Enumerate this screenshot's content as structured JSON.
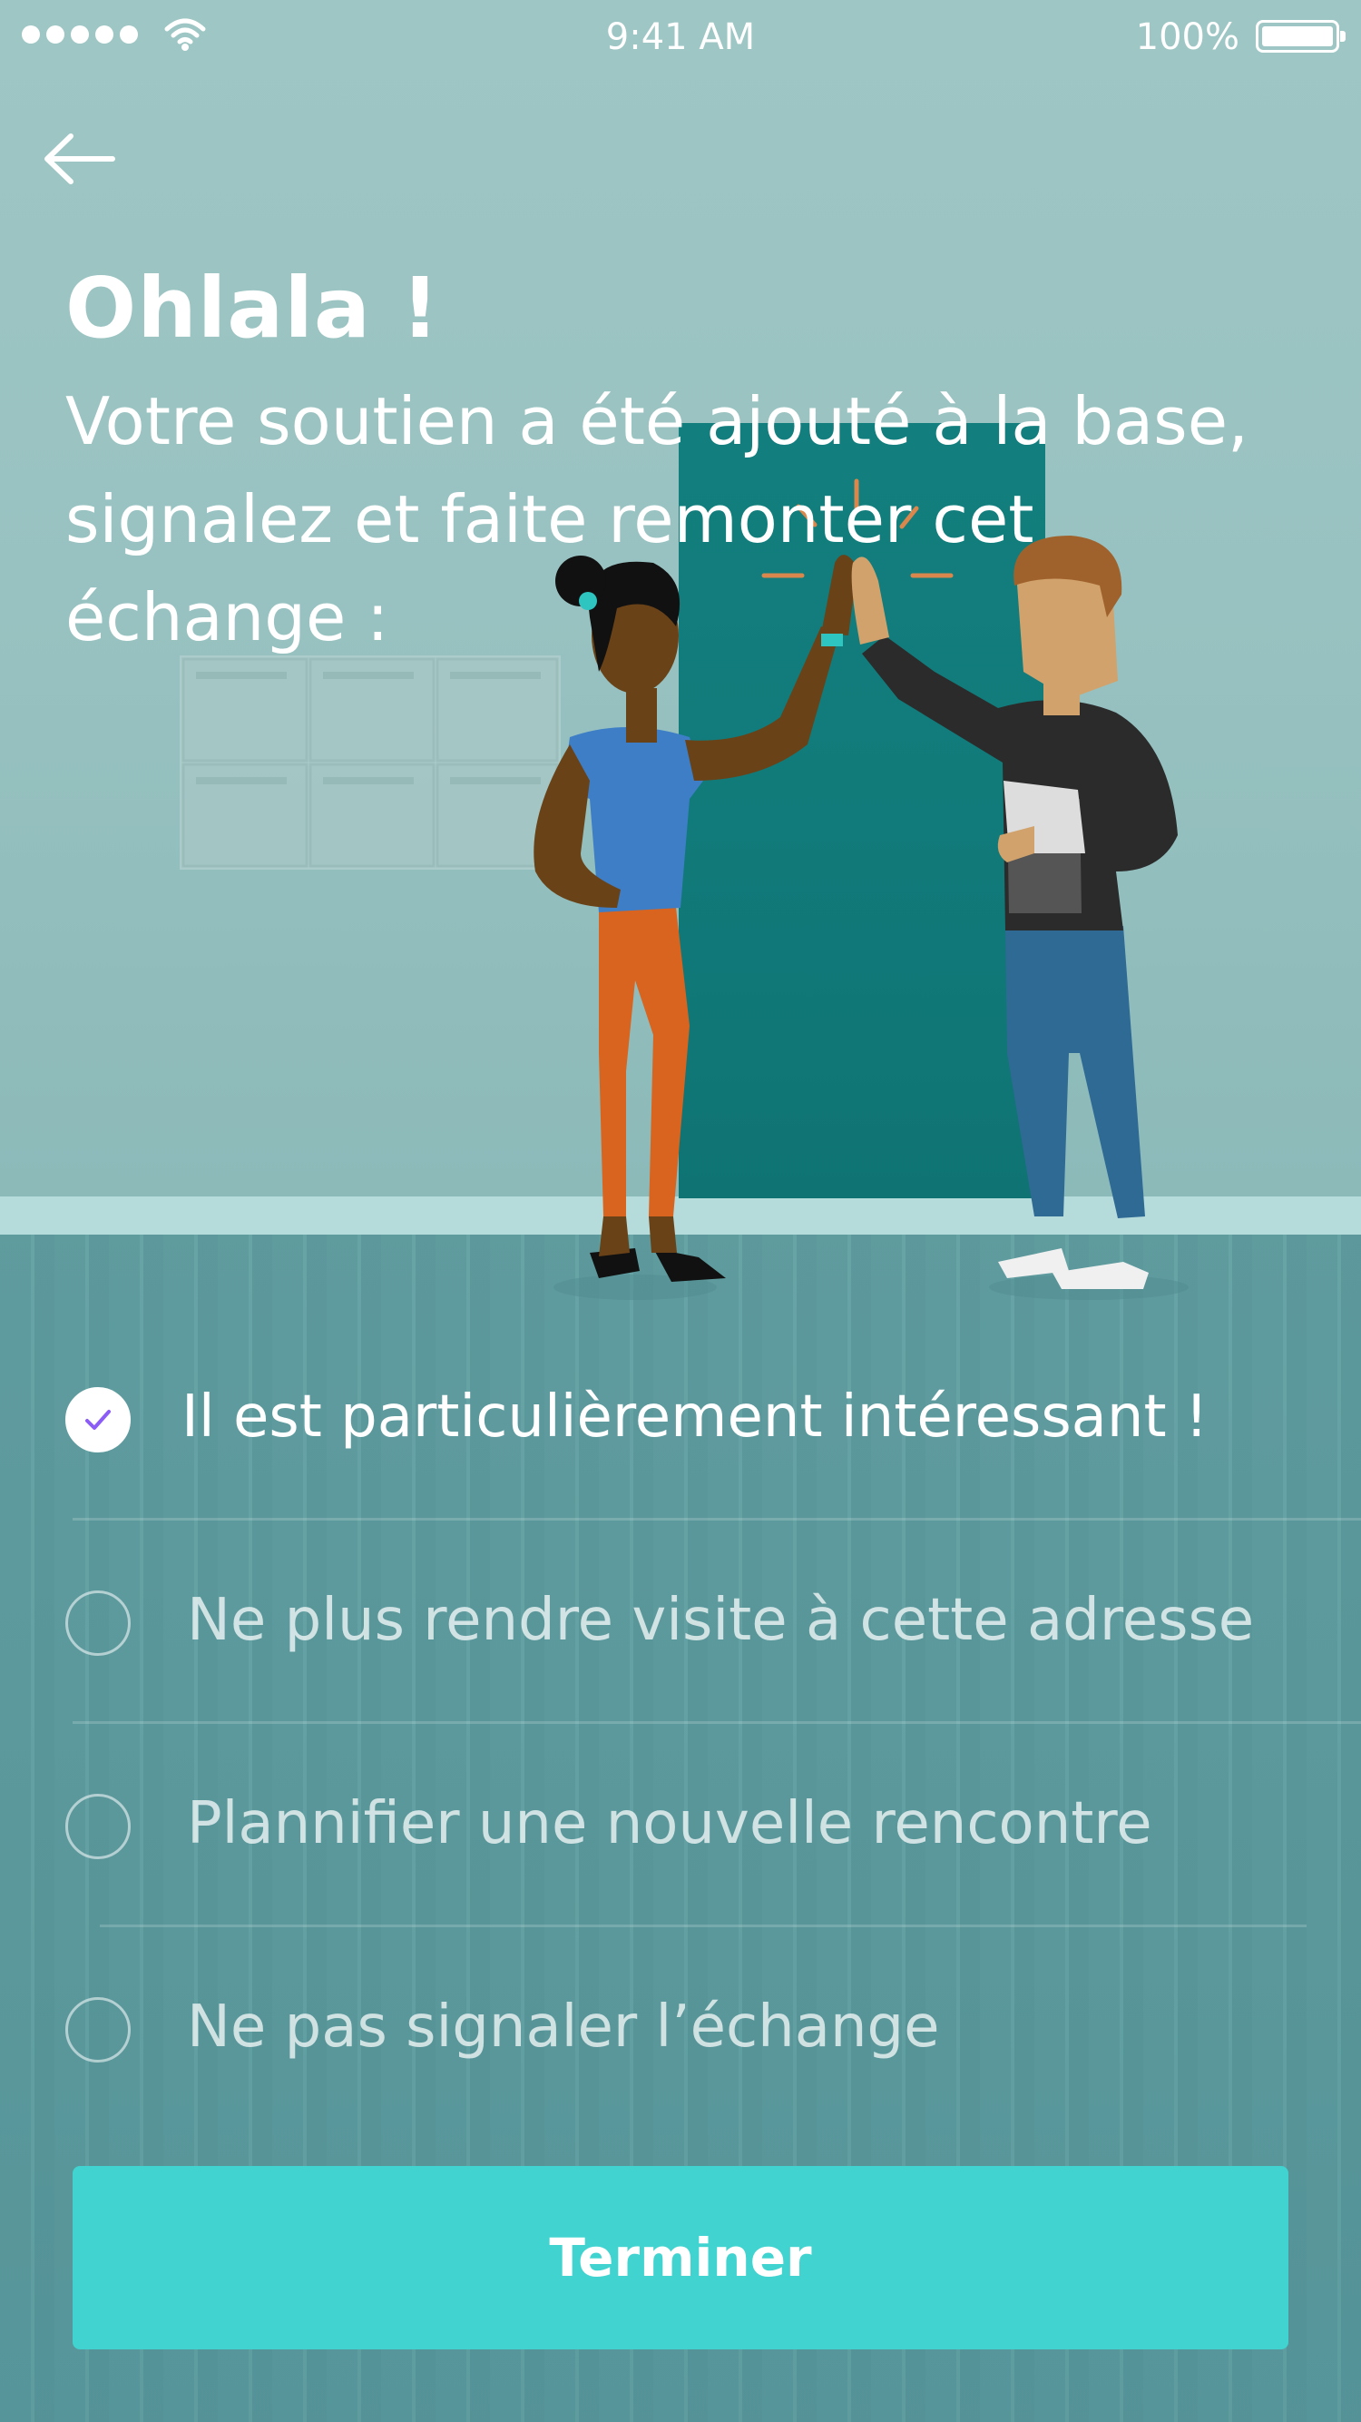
{
  "status_bar": {
    "time": "9:41 AM",
    "battery": "100%",
    "icons": [
      "signal-dots-icon",
      "wifi-icon",
      "battery-icon"
    ]
  },
  "nav": {
    "back_icon": "arrow-left-icon"
  },
  "header": {
    "title": "Ohlala !",
    "subtitle": "Votre soutien a été ajouté à la base, signalez et faite remonter cet échange :"
  },
  "options": [
    {
      "label": "Il est particulièrement intéressant  !",
      "checked": true
    },
    {
      "label": "Ne plus rendre visite à cette adresse",
      "checked": false
    },
    {
      "label": "Plannifier une nouvelle rencontre",
      "checked": false
    },
    {
      "label": "Ne pas signaler l’échange",
      "checked": false
    }
  ],
  "actions": {
    "finish_label": "Terminer"
  },
  "colors": {
    "accent": "#41d3cf",
    "check": "#8b5cf6",
    "wall": "#9ec6c4",
    "floor": "#5f9a9e",
    "door": "#127e7d"
  }
}
